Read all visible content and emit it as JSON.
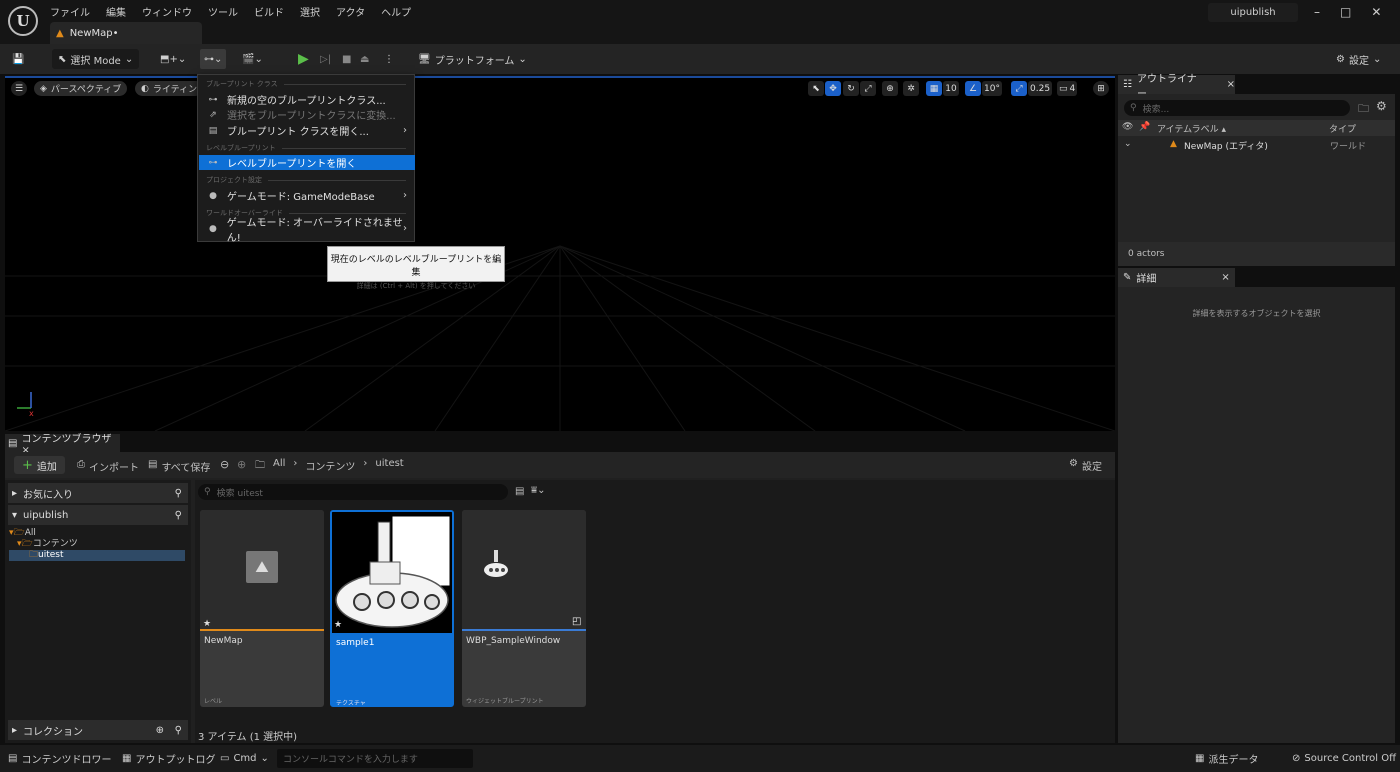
{
  "app": {
    "logo": "U",
    "map_tab": "NewMap•",
    "project": "uipublish",
    "window_buttons": [
      "–",
      "□",
      "✕"
    ]
  },
  "menu": [
    "ファイル",
    "編集",
    "ウィンドウ",
    "ツール",
    "ビルド",
    "選択",
    "アクタ",
    "ヘルプ"
  ],
  "toolbar": {
    "mode": "選択 Mode",
    "platform": "プラットフォーム",
    "settings": "設定"
  },
  "viewport": {
    "perspective": "パースペクティブ",
    "lighting": "ライティン",
    "grid": "10",
    "angle": "10°",
    "scale": "0.25",
    "camera": "4"
  },
  "dropdown": {
    "sec_bp_class": "ブループリント クラス",
    "new_bp_class": "新規の空のブループリントクラス...",
    "convert_bp": "選択をブループリントクラスに変換...",
    "open_bp_class": "ブループリント クラスを開く...",
    "sec_level_bp": "レベルブループリント",
    "open_level_bp": "レベルブループリントを開く",
    "sec_project": "プロジェクト設定",
    "game_mode": "ゲームモード: GameModeBase",
    "sec_world": "ワールドオーバーライド",
    "game_mode_override": "ゲームモード: オーバーライドされません!"
  },
  "tooltip": {
    "title": "現在のレベルのレベルブループリントを編集",
    "hint": "詳細は (Ctrl + Alt) を押してください"
  },
  "outliner": {
    "tab": "アウトライナー",
    "close": "×",
    "search_placeholder": "検索...",
    "col_label": "アイテムラベル ▴",
    "col_type": "タイプ",
    "row_name": "NewMap (エディタ)",
    "row_type": "ワールド",
    "actors": "0 actors"
  },
  "details": {
    "tab": "詳細",
    "close": "×",
    "empty": "詳細を表示するオブジェクトを選択"
  },
  "content_browser": {
    "tab": "コンテンツブラウザ ×",
    "add": "追加",
    "import": "インポート",
    "save_all": "すべて保存",
    "breadcrumb": [
      "All",
      "コンテンツ",
      "uitest"
    ],
    "settings": "設定",
    "favorites": "お気に入り",
    "project": "uipublish",
    "tree": [
      "All",
      "コンテンツ",
      "uitest"
    ],
    "collections": "コレクション",
    "search_placeholder": "検索 uitest",
    "status": "3 アイテム (1 選択中)",
    "assets": [
      {
        "name": "NewMap",
        "type": "レベル"
      },
      {
        "name": "sample1",
        "type": "テクスチャ"
      },
      {
        "name": "WBP_SampleWindow",
        "type": "ウィジェットブループリント"
      }
    ]
  },
  "statusbar": {
    "drawer": "コンテンツドロワー",
    "output_log": "アウトプットログ",
    "cmd": "Cmd",
    "console_placeholder": "コンソールコマンドを入力します",
    "derived_data": "派生データ",
    "source_control": "Source Control Off"
  },
  "colors": {
    "accent": "#0e70d6",
    "level_underline": "#e08a1a",
    "widget_underline": "#3a7bd5"
  }
}
